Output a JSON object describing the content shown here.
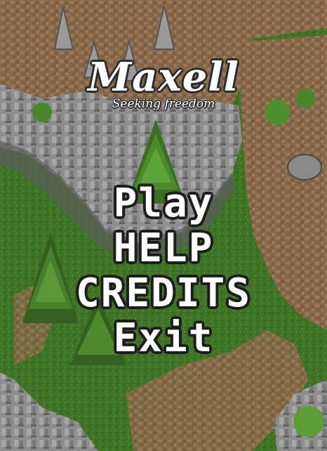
{
  "game": {
    "title": "Maxell",
    "subtitle": "Seeking freedom"
  },
  "menu": {
    "play": "Play",
    "help": "HELP",
    "credits": "CREDITS",
    "exit": "Exit"
  },
  "colors": {
    "grass": "#3c6b24",
    "grass_light": "#4f8a2f",
    "dirt": "#8a6a4b",
    "rock": "#8c8c8c",
    "text": "#ffffff",
    "outline": "#1d1d1d"
  }
}
